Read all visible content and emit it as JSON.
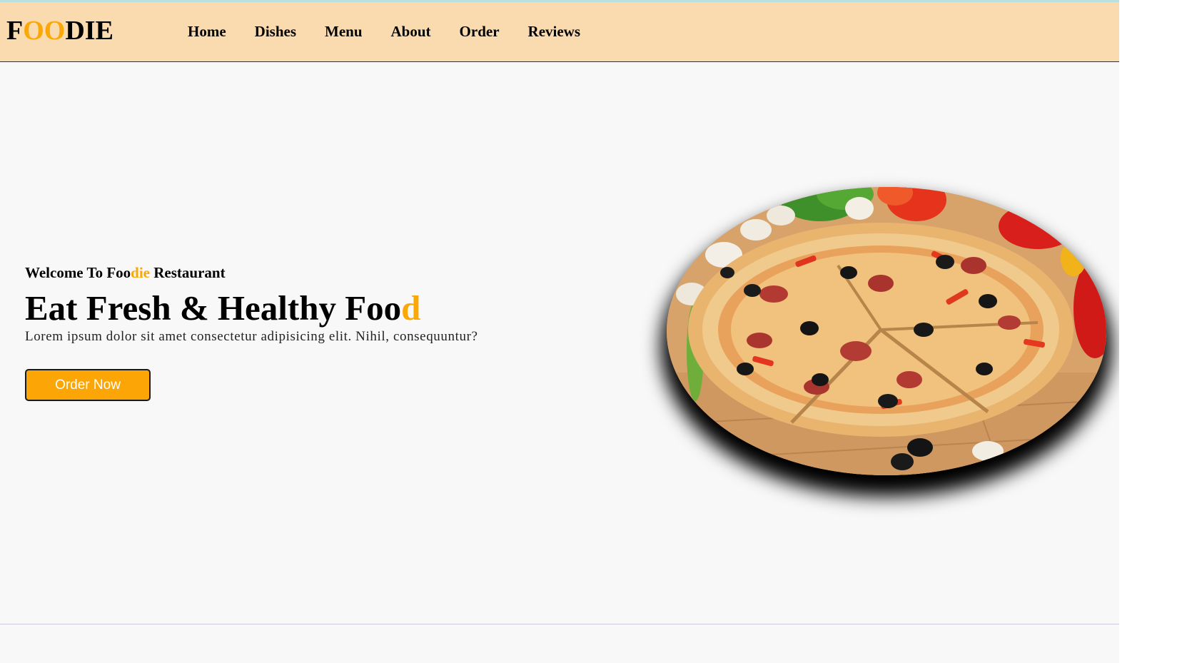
{
  "brand": {
    "logo_prefix": "F",
    "logo_accent": "OO",
    "logo_suffix": "DIE",
    "accent_color": "#f9a806",
    "nav_bg_color": "#fadbb0",
    "button_color": "#fca506"
  },
  "nav": {
    "items": [
      {
        "label": "Home"
      },
      {
        "label": "Dishes"
      },
      {
        "label": "Menu"
      },
      {
        "label": "About"
      },
      {
        "label": "Order"
      },
      {
        "label": "Reviews"
      }
    ]
  },
  "hero": {
    "welcome_prefix": "Welcome To Foo",
    "welcome_accent": "die",
    "welcome_suffix": " Restaurant",
    "headline_main": "Eat Fresh & Healthy Foo",
    "headline_accent": "d",
    "tagline": "Lorem ipsum dolor sit amet consectetur adipisicing elit. Nihil, consequuntur?",
    "button_label": "Order Now",
    "image_subject": "pizza-photo"
  }
}
